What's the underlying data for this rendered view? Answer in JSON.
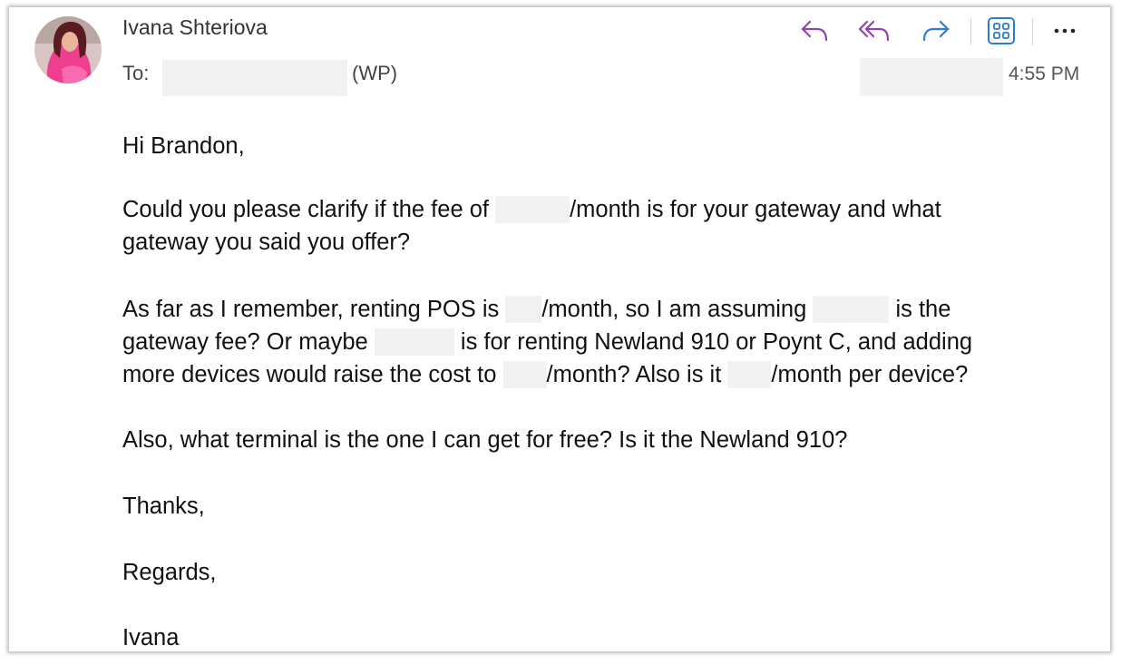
{
  "header": {
    "sender": "Ivana Shteriova",
    "to_label": "To:",
    "to_suffix": "(WP)",
    "time": "4:55 PM"
  },
  "actions": {
    "reply": "reply-icon",
    "reply_all": "reply-all-icon",
    "forward": "forward-icon",
    "apps": "apps-grid-icon",
    "more": "more-icon",
    "accent_purple": "#8e44ad",
    "accent_blue": "#2b7cd3"
  },
  "body": {
    "greeting": "Hi Brandon,",
    "p1_l1_a": "Could you please clarify if the fee of ",
    "p1_l1_b": "/month is for your gateway and what",
    "p1_l2": "gateway you said you offer?",
    "p2_l1_a": "As far as I remember, renting POS is ",
    "p2_l1_b": "/month, so I am assuming ",
    "p2_l1_c": " is the",
    "p2_l2_a": "gateway fee? Or maybe ",
    "p2_l2_b": " is for renting Newland 910 or Poynt C, and adding",
    "p2_l3_a": "more devices would raise the cost to ",
    "p2_l3_b": "/month? Also is it ",
    "p2_l3_c": "/month per device?",
    "p3": "Also, what terminal is the one I can get for free? Is it the Newland 910?",
    "thanks": "Thanks,",
    "regards": "Regards,",
    "signature": "Ivana"
  }
}
